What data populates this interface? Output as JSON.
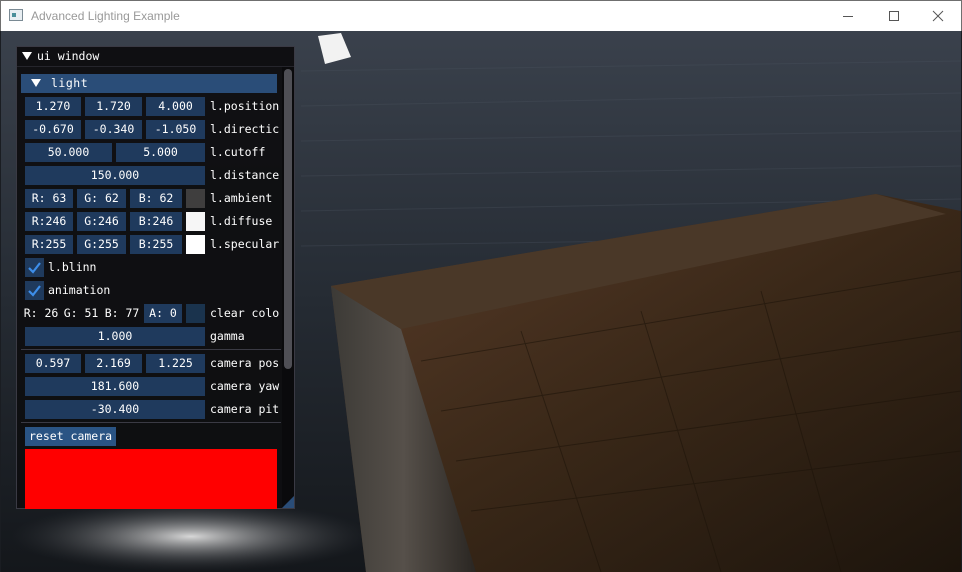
{
  "window": {
    "title": "Advanced Lighting Example"
  },
  "ui_window": {
    "title": "ui window",
    "light_header": "light",
    "light": {
      "position": {
        "label": "l.position",
        "values": [
          "1.270",
          "1.720",
          "4.000"
        ]
      },
      "direction": {
        "label": "l.directic",
        "values": [
          "-0.670",
          "-0.340",
          "-1.050"
        ]
      },
      "cutoff": {
        "label": "l.cutoff",
        "values": [
          "50.000",
          "5.000"
        ]
      },
      "distance": {
        "label": "l.distance",
        "value": "150.000"
      },
      "ambient": {
        "label": "l.ambient",
        "values": [
          "R: 63",
          "G: 62",
          "B: 62"
        ],
        "swatch": "#3f3e3e"
      },
      "diffuse": {
        "label": "l.diffuse",
        "values": [
          "R:246",
          "G:246",
          "B:246"
        ],
        "swatch": "#f6f6f6"
      },
      "specular": {
        "label": "l.specular",
        "values": [
          "R:255",
          "G:255",
          "B:255"
        ],
        "swatch": "#ffffff"
      },
      "blinn": {
        "label": "l.blinn",
        "checked": true
      }
    },
    "animation": {
      "label": "animation",
      "checked": true
    },
    "clear_color": {
      "label": "clear colo",
      "values": [
        "R: 26",
        "G: 51",
        "B: 77",
        "A:  0"
      ],
      "swatch": "#1a334d"
    },
    "gamma": {
      "label": "gamma",
      "value": "1.000"
    },
    "camera_pos": {
      "label": "camera pos",
      "values": [
        "0.597",
        "2.169",
        "1.225"
      ]
    },
    "camera_yaw": {
      "label": "camera yaw",
      "value": "181.600"
    },
    "camera_pitch": {
      "label": "camera pit",
      "value": "-30.400"
    },
    "reset_button": "reset camera",
    "preview_color": "#ff0000"
  }
}
